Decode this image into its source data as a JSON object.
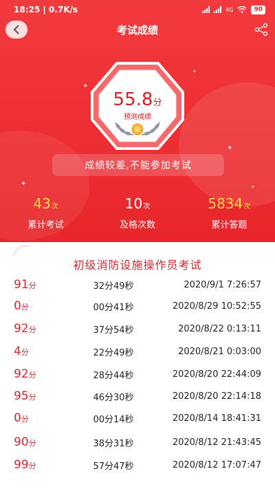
{
  "status_bar": {
    "time_speed": "18:25 | 0.7K/s",
    "network": "4G",
    "battery": "90"
  },
  "header": {
    "title": "考试成绩"
  },
  "score_card": {
    "value": "55.8",
    "unit": "分",
    "caption": "预测成绩"
  },
  "notice": "成绩较差,不能参加考试",
  "stats": [
    {
      "value": "43",
      "unit": "次",
      "label": "累计考试"
    },
    {
      "value": "10",
      "unit": "次",
      "label": "及格次数"
    },
    {
      "value": "5834",
      "unit": "次",
      "label": "累计答题"
    }
  ],
  "exam_list": {
    "title": "初级消防设施操作员考试",
    "rows": [
      {
        "score": "91",
        "unit": "分",
        "duration": "32分49秒",
        "date": "2020/9/1 7:26:57"
      },
      {
        "score": "0",
        "unit": "分",
        "duration": "00分41秒",
        "date": "2020/8/29 10:52:55"
      },
      {
        "score": "92",
        "unit": "分",
        "duration": "37分54秒",
        "date": "2020/8/22 0:13:11"
      },
      {
        "score": "4",
        "unit": "分",
        "duration": "22分49秒",
        "date": "2020/8/21 0:03:00"
      },
      {
        "score": "92",
        "unit": "分",
        "duration": "28分44秒",
        "date": "2020/8/20 22:44:09"
      },
      {
        "score": "95",
        "unit": "分",
        "duration": "46分30秒",
        "date": "2020/8/20 22:14:18"
      },
      {
        "score": "0",
        "unit": "分",
        "duration": "00分14秒",
        "date": "2020/8/14 18:41:31"
      },
      {
        "score": "90",
        "unit": "分",
        "duration": "38分31秒",
        "date": "2020/8/12 21:43:45"
      },
      {
        "score": "99",
        "unit": "分",
        "duration": "57分47秒",
        "date": "2020/8/12 17:07:47"
      }
    ]
  },
  "colors": {
    "primary_red": "#ee3034",
    "score_red": "#d8282d",
    "stat_yellow": "#ffd84a"
  }
}
